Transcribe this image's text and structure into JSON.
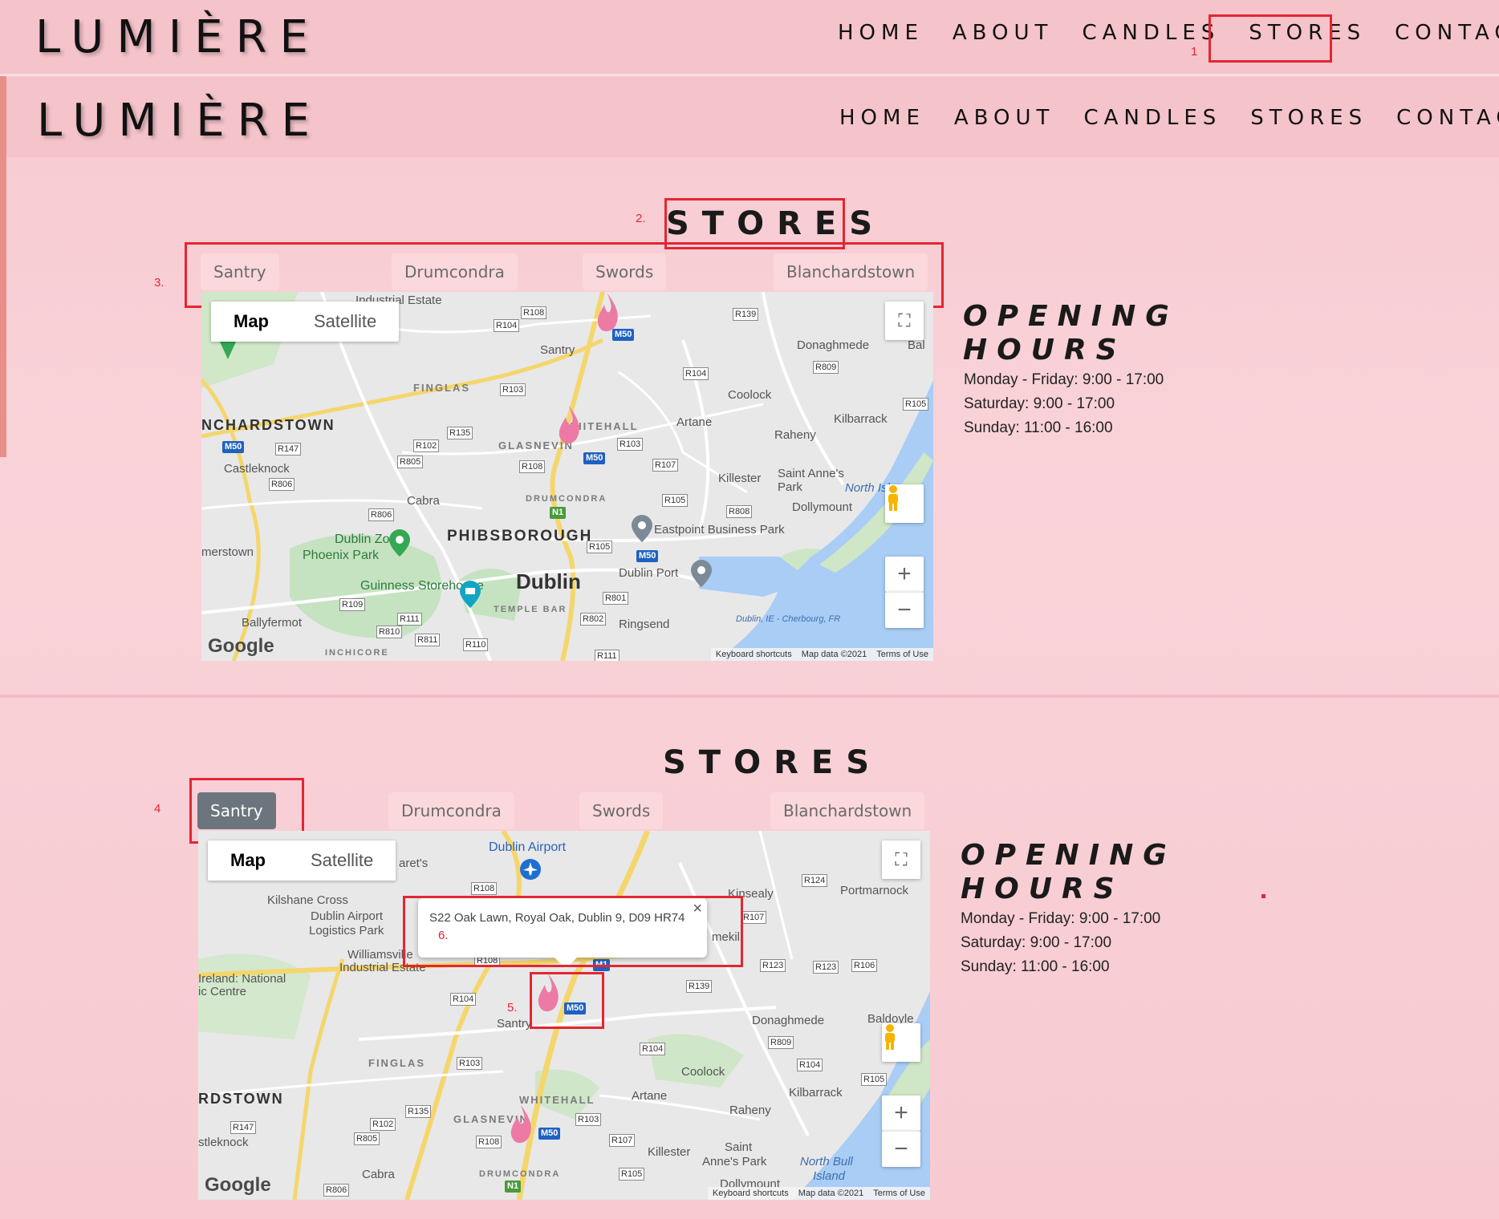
{
  "brand": {
    "logo": "LUMIÈRE"
  },
  "nav": [
    {
      "label": "HOME"
    },
    {
      "label": "ABOUT"
    },
    {
      "label": "CANDLES"
    },
    {
      "label": "STORES"
    },
    {
      "label": "CONTACT"
    }
  ],
  "annotations": [
    "1",
    "2.",
    "3.",
    "4",
    "5.",
    "6."
  ],
  "stores": {
    "title": "STORES",
    "tabs": [
      "Santry",
      "Drumcondra",
      "Swords",
      "Blanchardstown"
    ]
  },
  "map": {
    "type_map": "Map",
    "type_satellite": "Satellite",
    "zoom_in": "+",
    "zoom_out": "−",
    "footer_shortcuts": "Keyboard shortcuts",
    "footer_data": "Map data ©2021",
    "footer_terms": "Terms of Use",
    "logo": "Google",
    "labels1": {
      "santry": "Santry",
      "donaghmede": "Donaghmede",
      "finglas": "FINGLAS",
      "coolock": "Coolock",
      "blanch": "NCHARDSTOWN",
      "artane": "Artane",
      "kilbarrack": "Kilbarrack",
      "whitehall": "WHITEHALL",
      "glasnevin": "GLASNEVIN",
      "raheny": "Raheny",
      "castleknock": "Castleknock",
      "killester": "Killester",
      "saint_annes": "Saint Anne's Park",
      "north_island": "North Islan",
      "cabra": "Cabra",
      "drumcondra": "DRUMCONDRA",
      "dollymount": "Dollymount",
      "eastpoint": "Eastpoint Business Park",
      "dublin_zoo": "Dublin Zoo",
      "phibsborough": "PHIBSBOROUGH",
      "phoenix": "Phoenix Park",
      "merstown": "merstown",
      "dublin_port": "Dublin Port",
      "guinness": "Guinness Storehouse",
      "dublin": "Dublin",
      "temple_bar": "TEMPLE BAR",
      "ballyfermot": "Ballyfermot",
      "ringsend": "Ringsend",
      "inchicore": "INCHICORE",
      "ferry": "Dublin, IE - Cherbourg, FR",
      "industrial": "Industrial Estate",
      "bal": "Bal"
    },
    "labels2": {
      "airport": "Dublin Airport",
      "arets": "aret's",
      "kilshane": "Kilshane Cross",
      "kinsealy": "Kinsealy",
      "portmarnock": "Portmarnock",
      "airport_logistics": "Dublin Airport",
      "logistics_park": "Logistics Park",
      "williamsville": "Williamsville",
      "industrial": "Industrial Estate",
      "ireland_nat": "Ireland: National",
      "ic_centre": "ic Centre",
      "santry": "Santry",
      "donaghmede": "Donaghmede",
      "baldoyle": "Baldoyle",
      "finglas": "FINGLAS",
      "coolock": "Coolock",
      "rdstown": "RDSTOWN",
      "artane": "Artane",
      "kilbarrack": "Kilbarrack",
      "whitehall": "WHITEHALL",
      "raheny": "Raheny",
      "glasnevin": "GLASNEVIN",
      "stleknock": "stleknock",
      "killester": "Killester",
      "saint_annes": "Saint",
      "annes_park": "Anne's Park",
      "north_bull": "North Bull",
      "island": "Island",
      "cabra": "Cabra",
      "drumcondra": "DRUMCONDRA",
      "dollymount": "Dollymount",
      "mekil": "mekil"
    },
    "badges1": [
      "R108",
      "R139",
      "R104",
      "R809",
      "R103",
      "R104",
      "R105",
      "R135",
      "R147",
      "R102",
      "R103",
      "R805",
      "R108",
      "R107",
      "R806",
      "R105",
      "R808",
      "R806",
      "R105",
      "R109",
      "R111",
      "R801",
      "R810",
      "R811",
      "R110",
      "R802",
      "R111"
    ],
    "badges2": [
      "R108",
      "R124",
      "R107",
      "R108",
      "R123",
      "R123",
      "R106",
      "R104",
      "R139",
      "R809",
      "R103",
      "R104",
      "R104",
      "R105",
      "R147",
      "R102",
      "R135",
      "R103",
      "R805",
      "R108",
      "R107",
      "R806",
      "R105"
    ],
    "motorways": [
      "M50",
      "M50",
      "M50",
      "N1",
      "M50",
      "M1",
      "M50",
      "M50",
      "N1"
    ]
  },
  "hours": {
    "title_line1": "OPENING",
    "title_line2": "HOURS",
    "weekday": "Monday - Friday: 9:00 - 17:00",
    "saturday": "Saturday: 9:00 - 17:00",
    "sunday": "Sunday: 11:00 - 16:00"
  },
  "infowindow": {
    "address": "S22 Oak Lawn, Royal Oak, Dublin 9, D09 HR74",
    "close": "×"
  },
  "colors": {
    "header_bg": "#f5c3ca",
    "page_bg": "#f9d3d9",
    "annotation": "#e32632",
    "tab_active": "#6c757d",
    "pin": "#ec7aa4"
  }
}
